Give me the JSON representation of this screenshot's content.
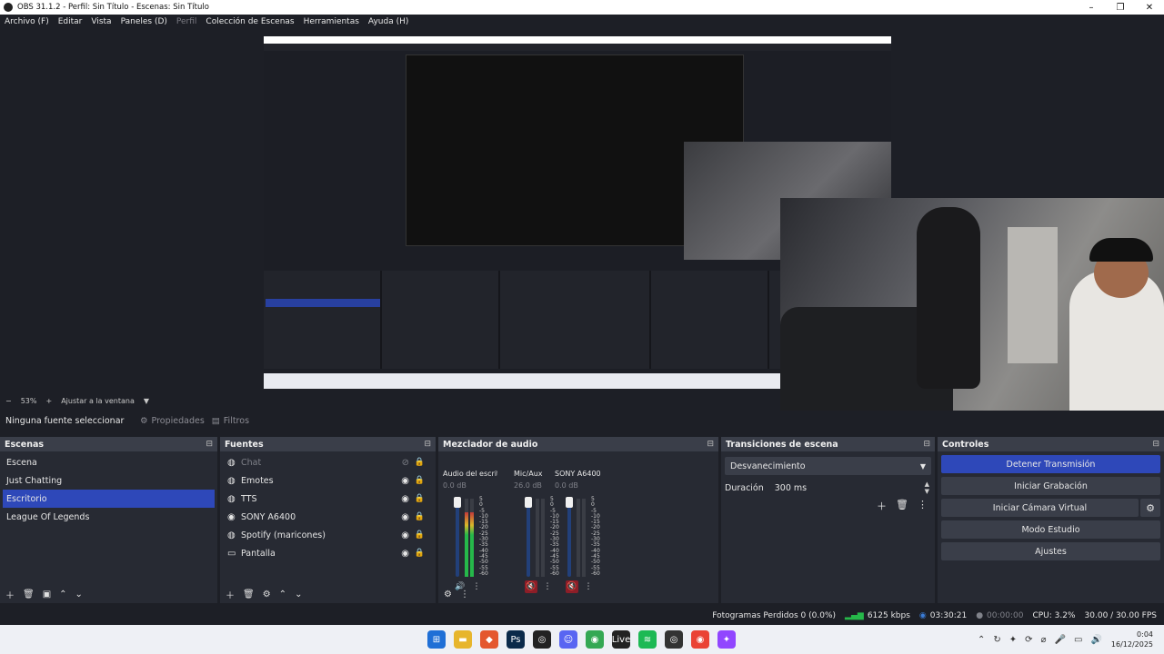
{
  "window": {
    "title": "OBS 31.1.2 - Perfil: Sin Título - Escenas: Sin Título",
    "controls": [
      "–",
      "❐",
      "✕"
    ]
  },
  "menu": [
    {
      "label": "Archivo (F)",
      "disabled": false
    },
    {
      "label": "Editar",
      "disabled": false
    },
    {
      "label": "Vista",
      "disabled": false
    },
    {
      "label": "Paneles (D)",
      "disabled": false
    },
    {
      "label": "Perfil",
      "disabled": true
    },
    {
      "label": "Colección de Escenas",
      "disabled": false
    },
    {
      "label": "Herramientas",
      "disabled": false
    },
    {
      "label": "Ayuda (H)",
      "disabled": false
    }
  ],
  "zoom": {
    "minus": "−",
    "value": "53%",
    "plus": "+",
    "fit_label": "Ajustar a la ventana",
    "caret": "▼"
  },
  "context": {
    "label": "Ninguna fuente seleccionar",
    "properties": "Propiedades",
    "filters": "Filtros"
  },
  "scenes": {
    "title": "Escenas",
    "items": [
      "Escena",
      "Just Chatting",
      "Escritorio",
      "League Of Legends"
    ],
    "selected": "Escritorio"
  },
  "sources": {
    "title": "Fuentes",
    "items": [
      {
        "name": "Chat",
        "icon": "browser-icon",
        "glyph": "◍",
        "hidden": true
      },
      {
        "name": "Emotes",
        "icon": "browser-icon",
        "glyph": "◍",
        "hidden": false
      },
      {
        "name": "TTS",
        "icon": "browser-icon",
        "glyph": "◍",
        "hidden": false
      },
      {
        "name": "SONY A6400",
        "icon": "camera-icon",
        "glyph": "◉",
        "hidden": false
      },
      {
        "name": "Spotify (maricones)",
        "icon": "browser-icon",
        "glyph": "◍",
        "hidden": false
      },
      {
        "name": "Pantalla",
        "icon": "display-icon",
        "glyph": "▭",
        "hidden": false
      }
    ]
  },
  "mixer": {
    "title": "Mezclador de audio",
    "scale": [
      "5",
      "0",
      "-5",
      "-10",
      "-15",
      "-20",
      "-25",
      "-30",
      "-35",
      "-40",
      "-45",
      "-50",
      "-55",
      "-60"
    ],
    "channels": [
      {
        "name": "Audio del escritorio",
        "db": "0.0 dB",
        "level": 0.82,
        "muted": false
      },
      {
        "name": "Mic/Aux",
        "db": "26.0 dB",
        "level": 0.0,
        "muted": true
      },
      {
        "name": "SONY A6400",
        "db": "0.0 dB",
        "level": 0.0,
        "muted": true
      }
    ]
  },
  "transitions": {
    "title": "Transiciones de escena",
    "selected": "Desvanecimiento",
    "duration_label": "Duración",
    "duration_value": "300 ms"
  },
  "controls": {
    "title": "Controles",
    "stop_stream": "Detener Transmisión",
    "start_recording": "Iniciar Grabación",
    "start_virtual_cam": "Iniciar Cámara Virtual",
    "studio_mode": "Modo Estudio",
    "settings": "Ajustes"
  },
  "status": {
    "dropped_frames": "Fotogramas Perdidos 0 (0.0%)",
    "bitrate": "6125 kbps",
    "stream_time": "03:30:21",
    "record_time": "00:00:00",
    "cpu": "CPU: 3.2%",
    "fps": "30.00 / 30.00 FPS"
  },
  "taskbar": {
    "apps": [
      {
        "icon": "windows-start-icon",
        "color": "#1f6fd6",
        "glyph": "⊞"
      },
      {
        "icon": "file-explorer-icon",
        "color": "#e7b52c",
        "glyph": "▬"
      },
      {
        "icon": "brave-browser-icon",
        "color": "#e4572e",
        "glyph": "◆"
      },
      {
        "icon": "photoshop-icon",
        "color": "#0b2a4a",
        "glyph": "Ps"
      },
      {
        "icon": "obs-icon",
        "color": "#222222",
        "glyph": "◎"
      },
      {
        "icon": "discord-icon",
        "color": "#5865f2",
        "glyph": "☺"
      },
      {
        "icon": "chrome-icon",
        "color": "#34a853",
        "glyph": "◉"
      },
      {
        "icon": "live-app-icon",
        "color": "#222222",
        "glyph": "Live"
      },
      {
        "icon": "spotify-icon",
        "color": "#1db954",
        "glyph": "≋"
      },
      {
        "icon": "obs-active-icon",
        "color": "#333333",
        "glyph": "◎"
      },
      {
        "icon": "chrome-profile-icon",
        "color": "#ea4335",
        "glyph": "◉"
      },
      {
        "icon": "twitch-icon",
        "color": "#9146ff",
        "glyph": "✦"
      }
    ],
    "time": "0:04",
    "date": "16/12/2025"
  }
}
